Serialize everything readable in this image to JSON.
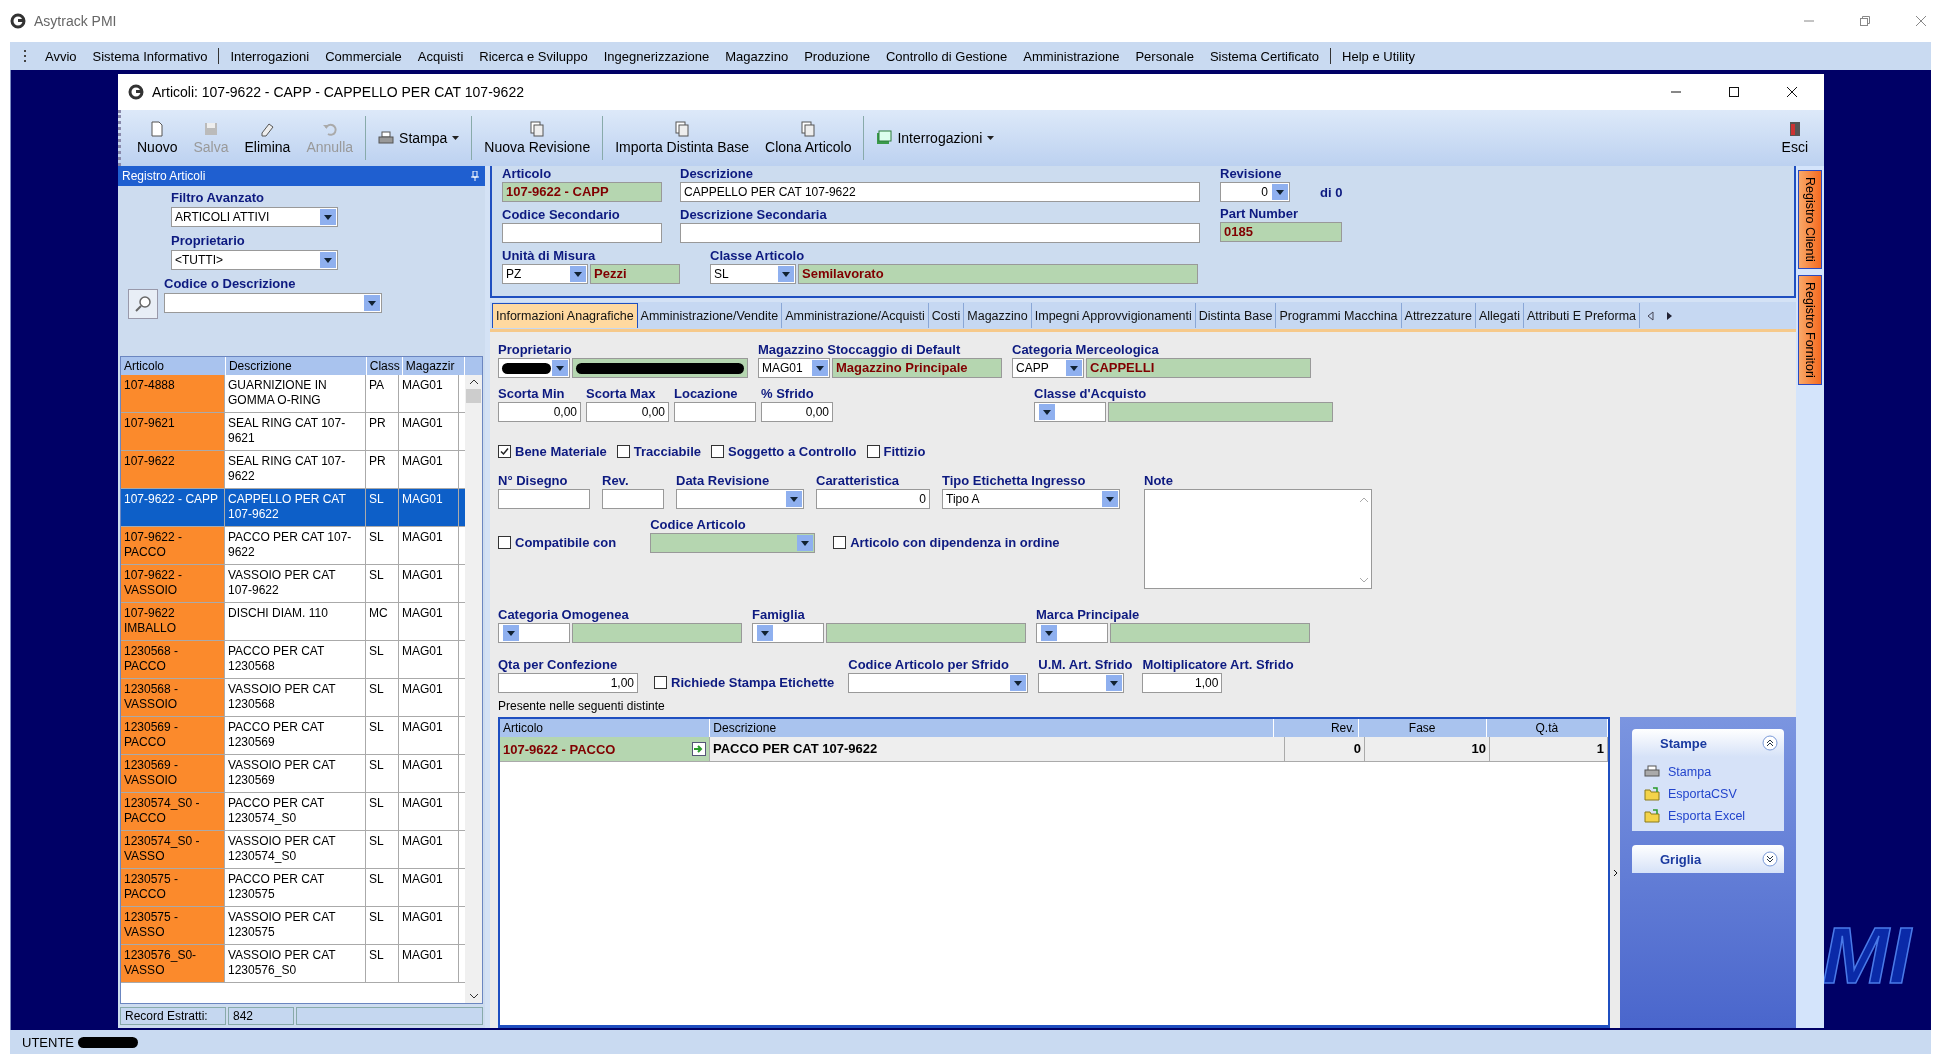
{
  "app": {
    "title": "Asytrack PMI",
    "user_label": "UTENTE",
    "desktop_logo": "MI"
  },
  "menu": [
    {
      "label": "Avvio",
      "kind": "item"
    },
    {
      "label": "Sistema Informativo",
      "kind": "item"
    },
    {
      "kind": "separator"
    },
    {
      "label": "Interrogazioni",
      "kind": "item"
    },
    {
      "label": "Commerciale",
      "kind": "item"
    },
    {
      "label": "Acquisti",
      "kind": "item"
    },
    {
      "label": "Ricerca e Sviluppo",
      "kind": "item"
    },
    {
      "label": "Ingegnerizzazione",
      "kind": "item"
    },
    {
      "label": "Magazzino",
      "kind": "item"
    },
    {
      "label": "Produzione",
      "kind": "item"
    },
    {
      "label": "Controllo di Gestione",
      "kind": "item"
    },
    {
      "label": "Amministrazione",
      "kind": "item"
    },
    {
      "label": "Personale",
      "kind": "item"
    },
    {
      "label": "Sistema Certificato",
      "kind": "item"
    },
    {
      "kind": "separator"
    },
    {
      "label": "Help e Utility",
      "kind": "item"
    }
  ],
  "window": {
    "title": "Articoli: 107-9622 - CAPP - CAPPELLO PER CAT 107-9622"
  },
  "toolbar": [
    {
      "label": "Nuovo",
      "kind": "button",
      "disabled": false
    },
    {
      "label": "Salva",
      "kind": "button",
      "disabled": true
    },
    {
      "label": "Elimina",
      "kind": "button",
      "disabled": false
    },
    {
      "label": "Annulla",
      "kind": "button",
      "disabled": true
    },
    {
      "kind": "separator"
    },
    {
      "label": "Stampa",
      "kind": "dropdown",
      "disabled": false
    },
    {
      "kind": "separator"
    },
    {
      "label": "Nuova Revisione",
      "kind": "button",
      "disabled": false
    },
    {
      "kind": "separator"
    },
    {
      "label": "Importa Distinta Base",
      "kind": "button",
      "disabled": false
    },
    {
      "label": "Clona Articolo",
      "kind": "button",
      "disabled": false
    },
    {
      "kind": "separator"
    },
    {
      "label": "Interrogazioni",
      "kind": "dropdown",
      "disabled": false
    },
    {
      "label": "Esci",
      "kind": "button",
      "disabled": false
    }
  ],
  "registro": {
    "title": "Registro Articoli",
    "filters": [
      {
        "label": "Filtro Avanzato",
        "value": "ARTICOLI ATTIVI"
      },
      {
        "label": "Proprietario",
        "value": "<TUTTI>"
      },
      {
        "label": "Codice o Descrizione"
      }
    ],
    "columns": [
      "Articolo",
      "Descrizione",
      "Class",
      "Magazzir"
    ],
    "rows": [
      {
        "articolo": "107-4888",
        "descrizione": "GUARNIZIONE IN GOMMA O-RING",
        "classe": "PA",
        "magazzino": "MAG01",
        "selected": false
      },
      {
        "articolo": "107-9621",
        "descrizione": "SEAL RING CAT 107-9621",
        "classe": "PR",
        "magazzino": "MAG01",
        "selected": false
      },
      {
        "articolo": "107-9622",
        "descrizione": "SEAL RING CAT 107-9622",
        "classe": "PR",
        "magazzino": "MAG01",
        "selected": false
      },
      {
        "articolo": "107-9622 - CAPP",
        "descrizione": "CAPPELLO PER CAT 107-9622",
        "classe": "SL",
        "magazzino": "MAG01",
        "selected": true
      },
      {
        "articolo": "107-9622 - PACCO",
        "descrizione": "PACCO PER CAT 107-9622",
        "classe": "SL",
        "magazzino": "MAG01",
        "selected": false
      },
      {
        "articolo": "107-9622 - VASSOIO",
        "descrizione": "VASSOIO PER CAT 107-9622",
        "classe": "SL",
        "magazzino": "MAG01",
        "selected": false
      },
      {
        "articolo": "107-9622 IMBALLO",
        "descrizione": "DISCHI DIAM. 110",
        "classe": "MC",
        "magazzino": "MAG01",
        "selected": false
      },
      {
        "articolo": "1230568 - PACCO",
        "descrizione": "PACCO PER CAT 1230568",
        "classe": "SL",
        "magazzino": "MAG01",
        "selected": false
      },
      {
        "articolo": "1230568 - VASSOIO",
        "descrizione": "VASSOIO PER CAT 1230568",
        "classe": "SL",
        "magazzino": "MAG01",
        "selected": false
      },
      {
        "articolo": "1230569 - PACCO",
        "descrizione": "PACCO PER CAT 1230569",
        "classe": "SL",
        "magazzino": "MAG01",
        "selected": false
      },
      {
        "articolo": "1230569 - VASSOIO",
        "descrizione": "VASSOIO PER CAT 1230569",
        "classe": "SL",
        "magazzino": "MAG01",
        "selected": false
      },
      {
        "articolo": "1230574_S0 - PACCO",
        "descrizione": "PACCO PER CAT 1230574_S0",
        "classe": "SL",
        "magazzino": "MAG01",
        "selected": false
      },
      {
        "articolo": "1230574_S0 - VASSO",
        "descrizione": "VASSOIO PER CAT 1230574_S0",
        "classe": "SL",
        "magazzino": "MAG01",
        "selected": false
      },
      {
        "articolo": "1230575 - PACCO",
        "descrizione": "PACCO PER CAT 1230575",
        "classe": "SL",
        "magazzino": "MAG01",
        "selected": false
      },
      {
        "articolo": "1230575 - VASSO",
        "descrizione": "VASSOIO PER CAT 1230575",
        "classe": "SL",
        "magazzino": "MAG01",
        "selected": false
      },
      {
        "articolo": "1230576_S0- VASSO",
        "descrizione": "VASSOIO PER CAT 1230576_S0",
        "classe": "SL",
        "magazzino": "MAG01",
        "selected": false
      }
    ],
    "record_label": "Record Estratti:",
    "record_count": "842"
  },
  "header": {
    "articolo": {
      "label": "Articolo",
      "value": "107-9622 - CAPP"
    },
    "descrizione": {
      "label": "Descrizione",
      "value": "CAPPELLO PER CAT 107-9622"
    },
    "revisione": {
      "label": "Revisione",
      "value": "0",
      "of": "di 0"
    },
    "codice_secondario": {
      "label": "Codice Secondario"
    },
    "descrizione_secondaria": {
      "label": "Descrizione Secondaria"
    },
    "part_number": {
      "label": "Part Number",
      "value": "0185"
    },
    "unita": {
      "label": "Unità di Misura",
      "code": "PZ",
      "value": "Pezzi"
    },
    "classe": {
      "label": "Classe Articolo",
      "code": "SL",
      "value": "Semilavorato"
    }
  },
  "tabs": [
    {
      "label": "Informazioni Anagrafiche",
      "selected": true
    },
    {
      "label": "Amministrazione/Vendite",
      "selected": false
    },
    {
      "label": "Amministrazione/Acquisti",
      "selected": false
    },
    {
      "label": "Costi",
      "selected": false
    },
    {
      "label": "Magazzino",
      "selected": false
    },
    {
      "label": "Impegni Approvvigionamenti",
      "selected": false
    },
    {
      "label": "Distinta Base",
      "selected": false
    },
    {
      "label": "Programmi Macchina",
      "selected": false
    },
    {
      "label": "Attrezzature",
      "selected": false
    },
    {
      "label": "Allegati",
      "selected": false
    },
    {
      "label": "Attributi E Preforma",
      "selected": false
    }
  ],
  "anagrafica": {
    "lookups": [
      {
        "label": "Proprietario",
        "redacted": true
      },
      {
        "label": "Magazzino Stoccaggio di Default",
        "code": "MAG01",
        "value": "Magazzino Principale",
        "redacted": false
      },
      {
        "label": "Categoria Merceologica",
        "code": "CAPP",
        "value": "CAPPELLI",
        "redacted": false
      }
    ],
    "stock_fields": [
      {
        "label": "Scorta Min",
        "value": "0,00"
      },
      {
        "label": "Scorta Max",
        "value": "0,00"
      },
      {
        "label": "Locazione"
      },
      {
        "label": "% Sfrido",
        "value": "0,00"
      }
    ],
    "classe_acquisto": {
      "label": "Classe d'Acquisto"
    },
    "flags": [
      {
        "label": "Bene Materiale",
        "checked": true
      },
      {
        "label": "Tracciabile",
        "checked": false
      },
      {
        "label": "Soggetto a Controllo",
        "checked": false
      },
      {
        "label": "Fittizio",
        "checked": false
      }
    ],
    "drawing_fields": [
      {
        "label": "N° Disegno",
        "kind": "text"
      },
      {
        "label": "Rev.",
        "kind": "text"
      },
      {
        "label": "Data Revisione",
        "kind": "combo"
      },
      {
        "label": "Caratteristica",
        "kind": "text",
        "value": "0"
      },
      {
        "label": "Tipo Etichetta Ingresso",
        "kind": "combo",
        "value": "Tipo A"
      }
    ],
    "note": {
      "label": "Note"
    },
    "compatibile": {
      "label": "Compatibile con",
      "checked": false
    },
    "codice_articolo": {
      "label": "Codice Articolo"
    },
    "dipendenza": {
      "label": "Articolo con dipendenza in ordine",
      "checked": false
    },
    "groups": [
      {
        "label": "Categoria Omogenea"
      },
      {
        "label": "Famiglia"
      },
      {
        "label": "Marca Principale"
      }
    ],
    "qta": {
      "label": "Qta per Confezione",
      "value": "1,00"
    },
    "stampa_etichette": {
      "label": "Richiede Stampa Etichette",
      "checked": false
    },
    "sfrido": [
      {
        "label": "Codice Articolo per Sfrido",
        "kind": "combo"
      },
      {
        "label": "U.M. Art. Sfrido",
        "kind": "combo"
      },
      {
        "label": "Moltiplicatore Art. Sfrido",
        "kind": "text",
        "value": "1,00"
      }
    ]
  },
  "distinte": {
    "caption": "Presente nelle seguenti distinte",
    "columns": [
      "Articolo",
      "Descrizione",
      "Rev.",
      "Fase",
      "Q.tà"
    ],
    "rows": [
      {
        "articolo": "107-9622 - PACCO",
        "descrizione": "PACCO PER CAT 107-9622",
        "rev": "0",
        "fase": "10",
        "qta": "1"
      }
    ]
  },
  "task_panel": [
    {
      "title": "Stampe",
      "expanded": true,
      "items": [
        "Stampa",
        "EsportaCSV",
        "Esporta Excel"
      ]
    },
    {
      "title": "Griglia",
      "expanded": false
    }
  ],
  "side_tabs": [
    "Registro Clienti",
    "Registro Fornitori"
  ]
}
